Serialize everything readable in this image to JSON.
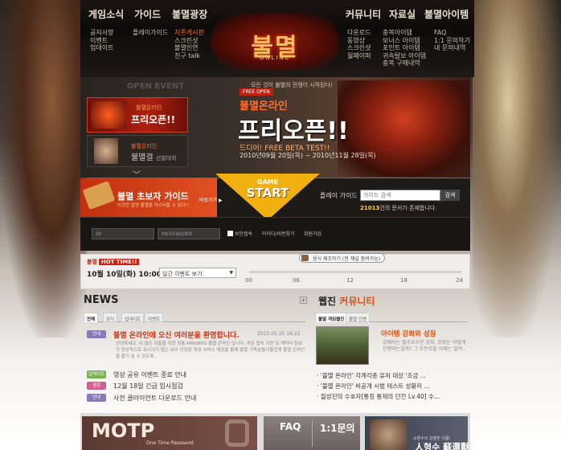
{
  "nav": {
    "items": [
      "게임소식",
      "가이드",
      "불멸광장",
      "커뮤니티",
      "자료실",
      "불멸아이템"
    ]
  },
  "submenu": {
    "col1": [
      "공지사항",
      "이벤트",
      "업데이트"
    ],
    "col2": [
      "플레이가이드"
    ],
    "col3": [
      "지존게시판",
      "스크린샷",
      "불멸인연",
      "친구 talk"
    ],
    "col4": [
      "다운로드",
      "동영상",
      "스크린샷",
      "월페이퍼"
    ],
    "col5": [
      "충복아이템",
      "보너스 아이템",
      "포인트 아이템",
      "귀속탈보 아이템",
      "충복 구매내역"
    ],
    "col6": [
      "FAQ",
      "1:1 문의하기",
      "내 문의내역"
    ]
  },
  "logo": {
    "title": "불멸",
    "sub": "ONLINE"
  },
  "banner": {
    "open_event": "OPEN EVENT",
    "thumb1_small": "불멸온라인",
    "thumb1_label": "프리오픈!!",
    "thumb2_small": "불멸온라인",
    "thumb2_label": "불멸걸",
    "thumb2_extra": "선발대회",
    "top_text": "모든 것이 불멸의 전쟁이 시작된다!",
    "tag": "FREE OPEN",
    "sub": "불멸온라인",
    "main": "프리오픈!!",
    "beta": "드디어! FREE BETA TEST!!",
    "date": "2010년09월 20일(목) ~ 2010년11월 28일(목)"
  },
  "guide": {
    "title": "불멸 초보자 가이드",
    "desc": "이것만 알면 불멸을 마스터할 수 있다!!",
    "btn": "바로가기 ▶"
  },
  "start": {
    "game": "GAME",
    "label": "START"
  },
  "play_guide": {
    "label": "플레이 가이드",
    "placeholder": "가이드 검색",
    "btn": "검색",
    "count": "21013",
    "count_suffix": "건의 문서가 존재합니다."
  },
  "login": {
    "id_label": "ID",
    "pw_label": "PASSWORD",
    "remember": "보안접속",
    "find": "아이디/비번찾기",
    "join": "회원가입"
  },
  "hottime": {
    "tag": "불멸",
    "tag_badge": "HOT TIME!!",
    "date": "10월 10일(화) 10:00",
    "select": "일간 이벤트 보기",
    "bubble": "음식 제조하기 (전 채널 참여가능)",
    "ticks": [
      "00",
      "06",
      "12",
      "18",
      "24"
    ]
  },
  "news": {
    "title": "NEWS",
    "more": "+",
    "tabs": [
      "전체",
      "공지",
      "업데이트",
      "이벤트"
    ],
    "main_badge": "안내",
    "main_title": "불멸 온라인에 오신 여러분을 환영합니다.",
    "main_date": "2010.05.25  16:22",
    "main_body": "안녕하세요. 더 많은 이들을 위한 정통 MMORPG 불멸 온라인 입니다. 게임 접속 지연 및 캐릭터 정보가 정상적으로 표시되지 않는 보다 안정된 게임 서비스 제공을 통해 불멸 가족분들이즐겁게 불멸 온라인을 즐기 실 수 있도록..",
    "items": [
      {
        "badge": "업데이트",
        "color": "#7ab050",
        "title": "영상 공유 이벤트 종료 안내"
      },
      {
        "badge": "점검",
        "color": "#d06090",
        "title": "12월 18일 긴급 임시점검"
      },
      {
        "badge": "안내",
        "color": "#8a7ab8",
        "title": "사전 클라이언트 다운로드 안내"
      }
    ]
  },
  "webzine": {
    "title_a": "웹진",
    "title_b": "커뮤니티",
    "tabs": [
      "불멸 게임웹진",
      "불멸 인벤"
    ],
    "feature_title": "아이템 강화와 성장",
    "feature_desc": "강해지는 필수요소인 강화. 강화는 어떻게 진행되는걸까? 그 모든것을 이제는 알려..",
    "items": [
      "· '불멸 온라인' 각계각층 유저 대상 '조금 ...",
      "· '불멸 온라인' 비공개 시범 테스트 성황리 ...",
      "· 칠성진의 수호자[통칭 퉁제의 던전 Lv.40] 수..."
    ]
  },
  "bottom": {
    "motp": "MOTP",
    "motp_sub": "One Time Password",
    "faq": "FAQ",
    "qna": "1:1문의",
    "wiki_small": "소환수의 강렬한 이름!",
    "wiki_title": "人형수 蘇還獸"
  }
}
